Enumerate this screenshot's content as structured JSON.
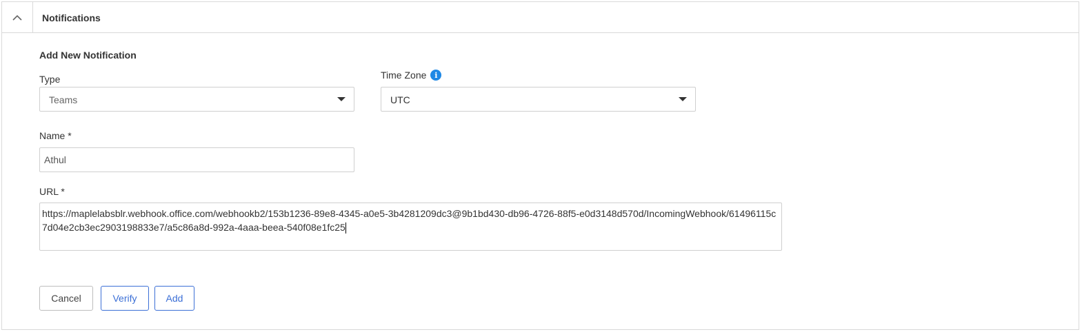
{
  "panel": {
    "title": "Notifications",
    "collapse_icon": "chevron-up-icon"
  },
  "form": {
    "section_title": "Add New Notification",
    "type": {
      "label": "Type",
      "value": "Teams"
    },
    "time_zone": {
      "label": "Time Zone",
      "info_icon": "info-icon",
      "value": "UTC"
    },
    "name": {
      "label": "Name *",
      "value": "Athul"
    },
    "url": {
      "label": "URL *",
      "value": "https://maplelabsblr.webhook.office.com/webhookb2/153b1236-89e8-4345-a0e5-3b4281209dc3@9b1bd430-db96-4726-88f5-e0d3148d570d/IncomingWebhook/61496115c7d04e2cb3ec2903198833e7/a5c86a8d-992a-4aaa-beea-540f08e1fc25"
    }
  },
  "actions": {
    "cancel_label": "Cancel",
    "verify_label": "Verify",
    "add_label": "Add"
  },
  "colors": {
    "accent": "#3b6fd6",
    "info": "#1e88e5",
    "border": "#d9d9d9"
  }
}
